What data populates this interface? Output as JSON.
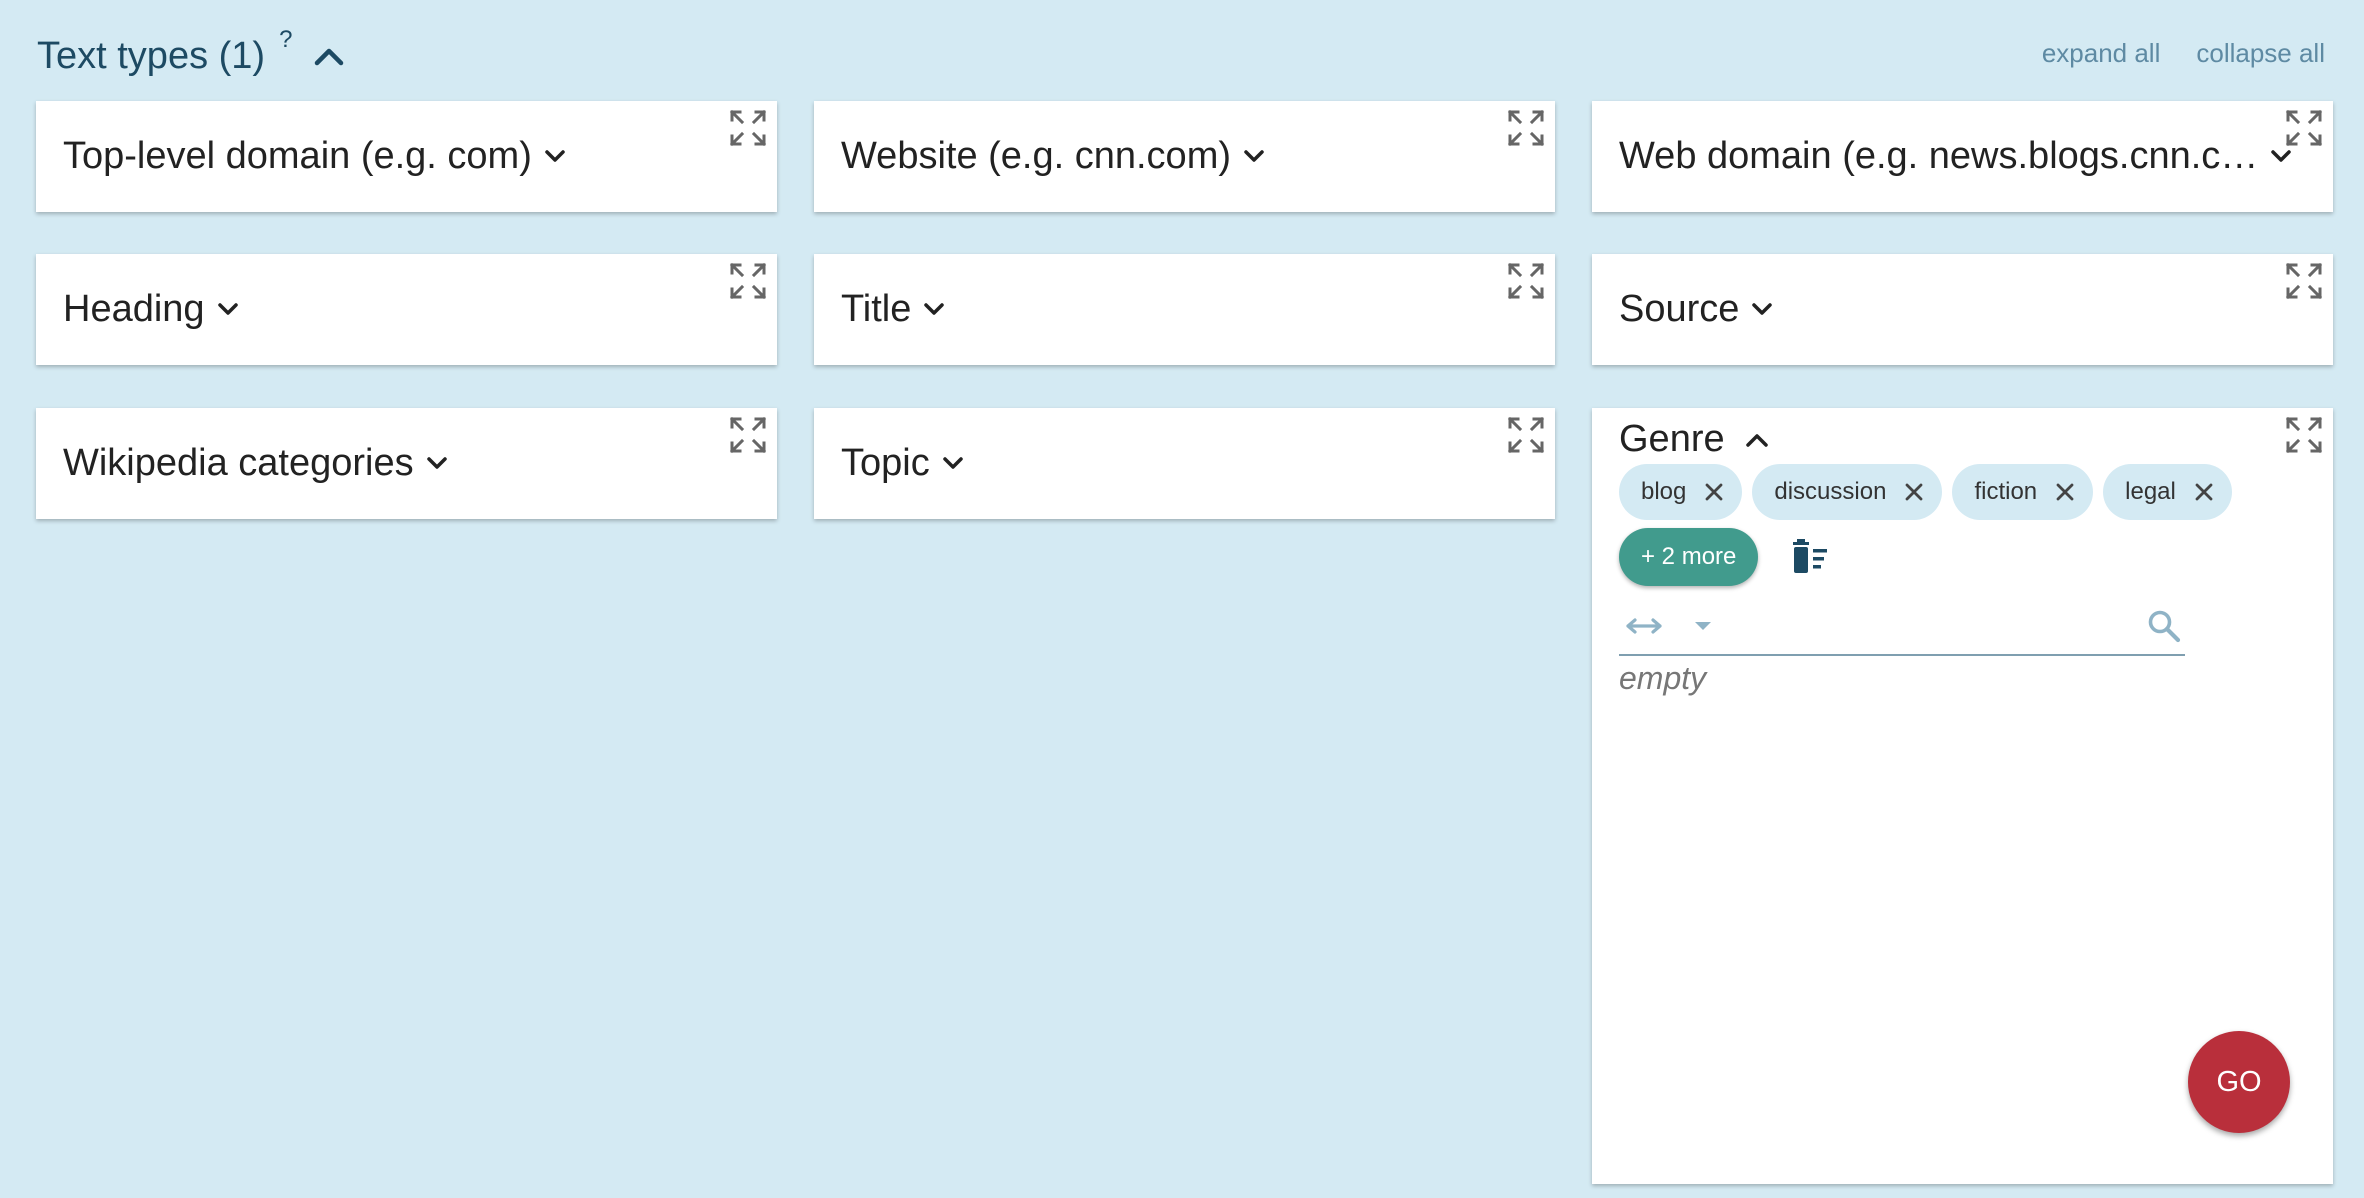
{
  "header": {
    "title": "Text types (1)",
    "help": "?"
  },
  "links": {
    "expand_all": "expand all",
    "collapse_all": "collapse all"
  },
  "cards": {
    "tld": "Top-level domain (e.g. com)",
    "website": "Website (e.g. cnn.com)",
    "webdomain": "Web domain (e.g. news.blogs.cnn.c…",
    "heading": "Heading",
    "title": "Title",
    "source": "Source",
    "wiki": "Wikipedia categories",
    "topic": "Topic",
    "genre": "Genre"
  },
  "genre": {
    "chips": [
      "blog",
      "discussion",
      "fiction",
      "legal"
    ],
    "more": "+ 2 more",
    "search_value": "",
    "empty": "empty"
  },
  "go": "GO",
  "colors": {
    "background": "#d4eaf3",
    "chip": "#d4eaf3",
    "more_button": "#419b8d",
    "go_button": "#b92f3b",
    "title": "#1d4a63"
  }
}
